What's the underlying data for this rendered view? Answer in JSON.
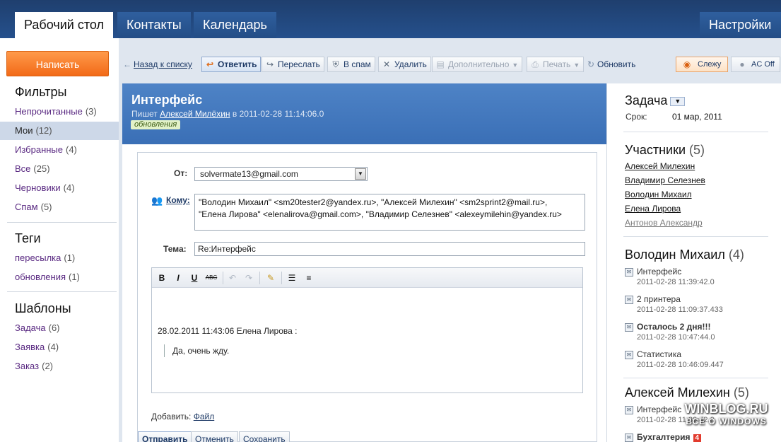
{
  "nav": {
    "tabs": [
      "Рабочий стол",
      "Контакты",
      "Календарь"
    ],
    "settings": "Настройки"
  },
  "sidebar": {
    "compose": "Написать",
    "filters_title": "Фильтры",
    "filters": [
      {
        "label": "Непрочитанные",
        "count": "(3)"
      },
      {
        "label": "Мои",
        "count": "(12)"
      },
      {
        "label": "Избранные",
        "count": "(4)"
      },
      {
        "label": "Все",
        "count": "(25)"
      },
      {
        "label": "Черновики",
        "count": "(4)"
      },
      {
        "label": "Спам",
        "count": "(5)"
      }
    ],
    "tags_title": "Теги",
    "tags": [
      {
        "label": "пересылка",
        "count": "(1)"
      },
      {
        "label": "обновления",
        "count": "(1)"
      }
    ],
    "templates_title": "Шаблоны",
    "templates": [
      {
        "label": "Задача",
        "count": "(6)"
      },
      {
        "label": "Заявка",
        "count": "(4)"
      },
      {
        "label": "Заказ",
        "count": "(2)"
      }
    ]
  },
  "toolbar": {
    "back": "Назад к списку",
    "reply": "Ответить",
    "forward": "Переслать",
    "spam": "В спам",
    "delete": "Удалить",
    "more": "Дополнительно",
    "print": "Печать",
    "refresh": "Обновить",
    "watch": "Слежу",
    "ac": "AC Off"
  },
  "message": {
    "title": "Интерфейс",
    "meta_prefix": "Пишет",
    "author": "Алексей Милёхин",
    "meta_suffix": "в 2011-02-28 11:14:06.0",
    "tag": "обновления"
  },
  "form": {
    "from_label": "От:",
    "from_value": "solvermate13@gmail.com",
    "to_label": "Кому:",
    "to_line1": "\"Володин Михаил\" <sm20tester2@yandex.ru>,  \"Алексей Милехин\" <sm2sprint2@mail.ru>,",
    "to_line2": "\"Елена Лирова\" <elenalirova@gmail.com>,  \"Владимир Селезнев\" <alexeymilehin@yandex.ru>",
    "subject_label": "Тема:",
    "subject_value": "Re:Интерфейс",
    "quote_header": "28.02.2011 11:43:06 Елена Лирова :",
    "quote_body": "Да, очень жду.",
    "attach_label": "Добавить:",
    "attach_link": "Файл",
    "send": "Отправить",
    "cancel": "Отменить",
    "save": "Сохранить"
  },
  "editor": {
    "bold": "B",
    "italic": "I",
    "underline": "U",
    "strike": "ABC"
  },
  "right": {
    "task_title": "Задача",
    "due_label": "Срок:",
    "due_value": "01 мар, 2011",
    "participants_title": "Участники",
    "participants_count": "(5)",
    "participants": [
      "Алексей Милехин",
      "Владимир Селезнев",
      "Володин Михаил",
      "Елена Лирова",
      "Антонов Александр"
    ],
    "group1_title": "Володин Михаил",
    "group1_count": "(4)",
    "group1": [
      {
        "title": "Интерфейс",
        "date": "2011-02-28 11:39:42.0"
      },
      {
        "title": "2 принтера",
        "date": "2011-02-28 11:09:37.433"
      },
      {
        "title": "Осталось 2 дня!!!",
        "date": "2011-02-28 10:47:44.0"
      },
      {
        "title": "Статистика",
        "date": "2011-02-28 10:46:09.447"
      }
    ],
    "group2_title": "Алексей Милехин",
    "group2_count": "(5)",
    "group2": [
      {
        "title": "Интерфейс",
        "date": "2011-02-28 11:39:42.0"
      },
      {
        "title": "Бухгалтерия",
        "badge": "4"
      }
    ]
  },
  "watermark": {
    "line1": "WINBLOG.RU",
    "line2": "ВСЁ О WINDOWS"
  }
}
